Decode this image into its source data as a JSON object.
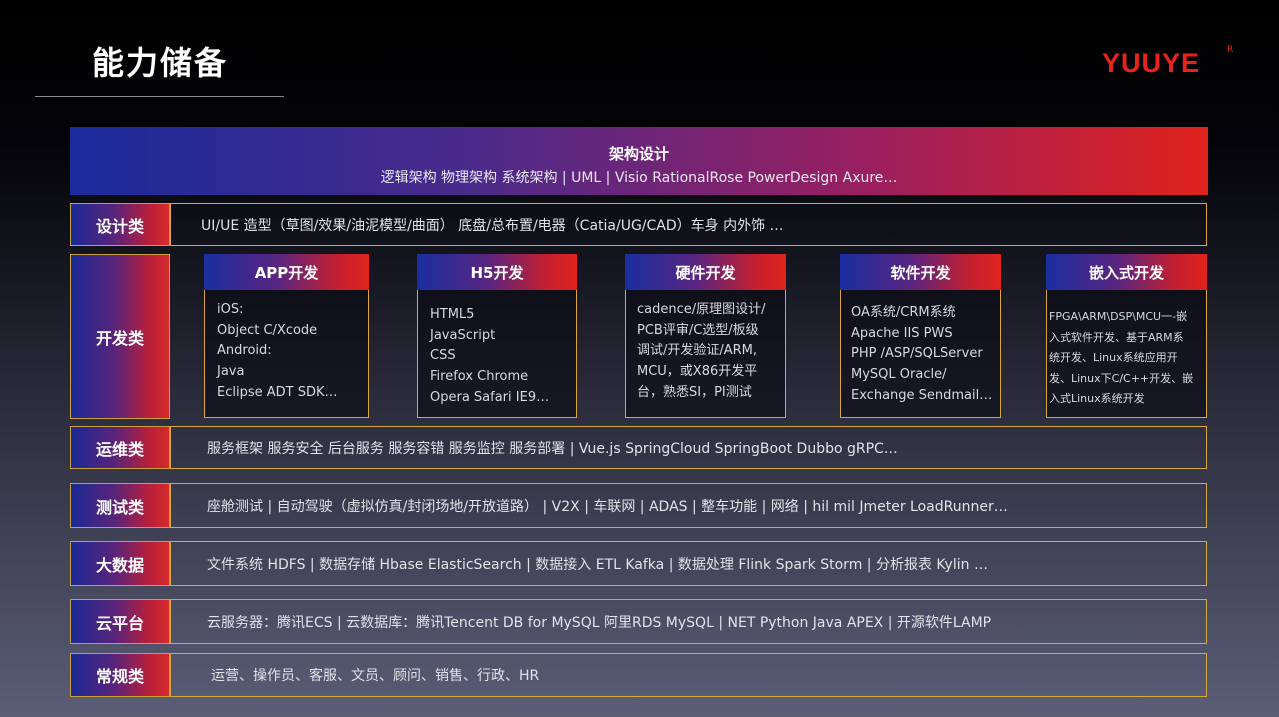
{
  "header": {
    "title": "能力储备",
    "logo": "YUUYE",
    "logo_mark": "R"
  },
  "architecture": {
    "title": "架构设计",
    "subtitle": "逻辑架构  物理架构  系统架构  |  UML  |  Visio  RationalRose  PowerDesign  Axure…"
  },
  "rows": {
    "design": {
      "label": "设计类",
      "text": "UI/UE  造型（草图/效果/油泥模型/曲面）  底盘/总布置/电器（Catia/UG/CAD）车身 内外饰 …"
    },
    "dev": {
      "label": "开发类"
    },
    "ops": {
      "label": "运维类",
      "text": "服务框架  服务安全  后台服务  服务容错  服务监控  服务部署  |  Vue.js  SpringCloud  SpringBoot  Dubbo  gRPC…"
    },
    "test": {
      "label": "测试类",
      "text": "座舱测试  |  自动驾驶（虚拟仿真/封闭场地/开放道路）  |  V2X |  车联网 |  ADAS | 整车功能 | 网络 |   hil mil Jmeter  LoadRunner…"
    },
    "bigdata": {
      "label": "大数据",
      "text": "文件系统  HDFS    |  数据存储  Hbase  ElasticSearch  |  数据接入  ETL  Kafka  | 数据处理  Flink  Spark  Storm   |  分析报表  Kylin  …"
    },
    "cloud": {
      "label": "云平台",
      "text": "云服务器：腾讯ECS   |  云数据库：腾讯Tencent DB for MySQL  阿里RDS MySQL   | NET  Python  Java  APEX   |  开源软件LAMP"
    },
    "general": {
      "label": "常规类",
      "text": "运营、操作员、客服、文员、顾问、销售、行政、HR"
    }
  },
  "dev_cards": [
    {
      "title": "APP开发",
      "lines": [
        "iOS:",
        "Object C/Xcode",
        "Android:",
        "Java",
        "Eclipse  ADT  SDK…"
      ]
    },
    {
      "title": "H5开发",
      "lines": [
        "HTML5",
        "JavaScript",
        "CSS",
        "Firefox  Chrome",
        "Opera  Safari  IE9…"
      ]
    },
    {
      "title": "硬件开发",
      "lines": [
        "cadence/原理图设计/",
        "PCB评审/C选型/板级",
        "调试/开发验证/ARM,",
        "MCU，或X86开发平",
        "台，熟悉SI，PI测试"
      ]
    },
    {
      "title": "软件开发",
      "lines": [
        "OA系统/CRM系统",
        "Apache  IIS  PWS",
        "PHP /ASP/SQLServer",
        "MySQL  Oracle/",
        "Exchange  Sendmail…"
      ]
    },
    {
      "title": "嵌入式开发",
      "lines": [
        "FPGA\\ARM\\DSP\\MCU一-嵌",
        "入式软件开发、基于ARM系",
        "统开发、Linux系统应用开",
        "发、Linux下C/C++开发、嵌",
        "入式Linux系统开发"
      ]
    }
  ],
  "colors": {
    "accent_gold": "#d7a93c",
    "brand_red": "#e8231a",
    "gradient_blue": "#1b2a95",
    "gradient_red": "#e0241c"
  }
}
